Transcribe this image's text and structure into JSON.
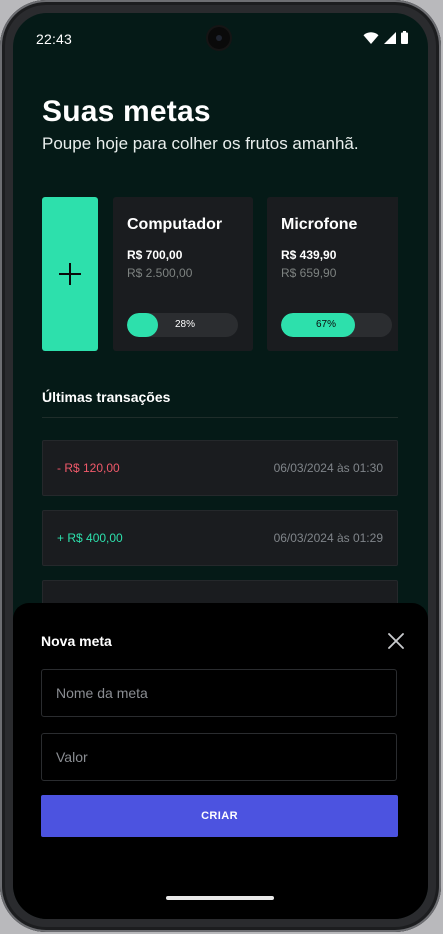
{
  "status": {
    "time": "22:43"
  },
  "header": {
    "title": "Suas metas",
    "subtitle": "Poupe hoje para colher os frutos amanhã."
  },
  "goals": [
    {
      "name": "Computador",
      "saved": "R$ 700,00",
      "target": "R$ 2.500,00",
      "progress_label": "28%",
      "progress": 0.28
    },
    {
      "name": "Microfone",
      "saved": "R$ 439,90",
      "target": "R$ 659,90",
      "progress_label": "67%",
      "progress": 0.67
    }
  ],
  "transactions": {
    "title": "Últimas transações",
    "items": [
      {
        "amount": "- R$ 120,00",
        "date": "06/03/2024 às 01:30",
        "type": "expense"
      },
      {
        "amount": "+ R$ 400,00",
        "date": "06/03/2024 às 01:29",
        "type": "income"
      }
    ]
  },
  "sheet": {
    "title": "Nova meta",
    "name_placeholder": "Nome da meta",
    "value_placeholder": "Valor",
    "create_label": "CRIAR"
  },
  "colors": {
    "background": "#051a17",
    "accent": "#2de0ac",
    "card": "#1a1c1f",
    "expense": "#f0596a",
    "income": "#2de0ac",
    "button": "#4c53e0"
  },
  "icons": {
    "add": "plus-icon",
    "close": "close-icon",
    "wifi": "wifi-icon",
    "signal": "signal-icon",
    "battery": "battery-icon"
  }
}
